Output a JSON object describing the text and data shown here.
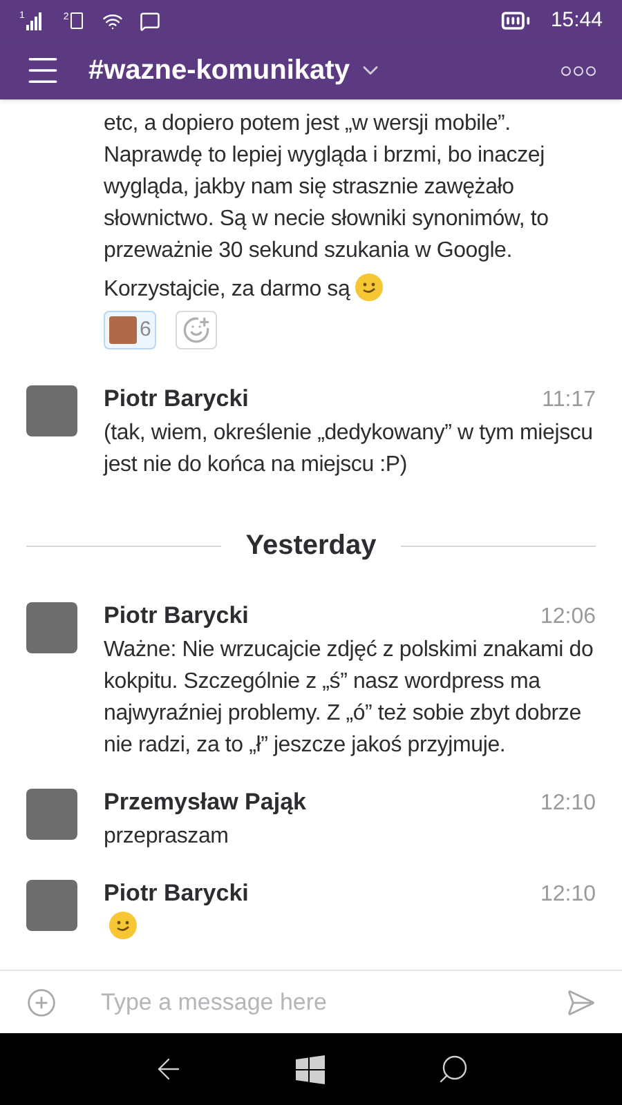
{
  "status_bar": {
    "sim1": "1",
    "sim2": "2",
    "time": "15:44"
  },
  "header": {
    "channel": "#wazne-komunikaty"
  },
  "messages": [
    {
      "kind": "continuation",
      "paragraphs": [
        {
          "text": "etc, a dopiero potem jest „w wersji mobile”. Naprawdę to lepiej wygląda i brzmi, bo inaczej wygląda, jakby nam się strasznie zawężało słownictwo. Są w necie słowniki synonimów, to przeważnie 30 sekund szukania w Google.",
          "emoji": false
        },
        {
          "text": "Korzystajcie, za darmo są",
          "emoji": true
        }
      ],
      "reactions": [
        {
          "count": "6",
          "selected": true
        }
      ]
    },
    {
      "kind": "message",
      "author": "Piotr Barycki",
      "time": "11:17",
      "paragraphs": [
        {
          "text": "(tak, wiem, określenie „dedykowany” w tym miejscu jest nie do końca na miejscu :P)",
          "emoji": false
        }
      ]
    },
    {
      "kind": "divider",
      "label": "Yesterday"
    },
    {
      "kind": "message",
      "author": "Piotr Barycki",
      "time": "12:06",
      "paragraphs": [
        {
          "text": "Ważne: Nie wrzucajcie zdjęć z polskimi znakami do kokpitu. Szczególnie z „ś” nasz wordpress ma najwyraźniej problemy. Z „ó” też sobie zbyt dobrze nie radzi, za to „ł” jeszcze jakoś przyjmuje.",
          "emoji": false
        }
      ]
    },
    {
      "kind": "message",
      "author": "Przemysław Pająk",
      "time": "12:10",
      "paragraphs": [
        {
          "text": "przepraszam",
          "emoji": false
        }
      ]
    },
    {
      "kind": "message",
      "author": "Piotr Barycki",
      "time": "12:10",
      "paragraphs": [
        {
          "emoji": true
        }
      ]
    }
  ],
  "composer": {
    "placeholder": "Type a message here"
  }
}
